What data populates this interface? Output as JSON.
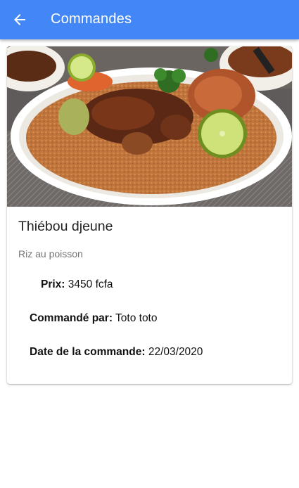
{
  "appbar": {
    "title": "Commandes",
    "back_icon": "arrow-left-icon",
    "background_color": "#4287f5"
  },
  "order": {
    "image_alt": "Photo du plat Thiébou djeune",
    "dish_name": "Thiébou djeune",
    "description": "Riz au poisson",
    "price_label": "Prix:",
    "price_value": "3450 fcfa",
    "ordered_by_label": "Commandé par:",
    "ordered_by_value": "Toto toto",
    "date_label": "Date de la commande:",
    "date_value": "22/03/2020"
  }
}
